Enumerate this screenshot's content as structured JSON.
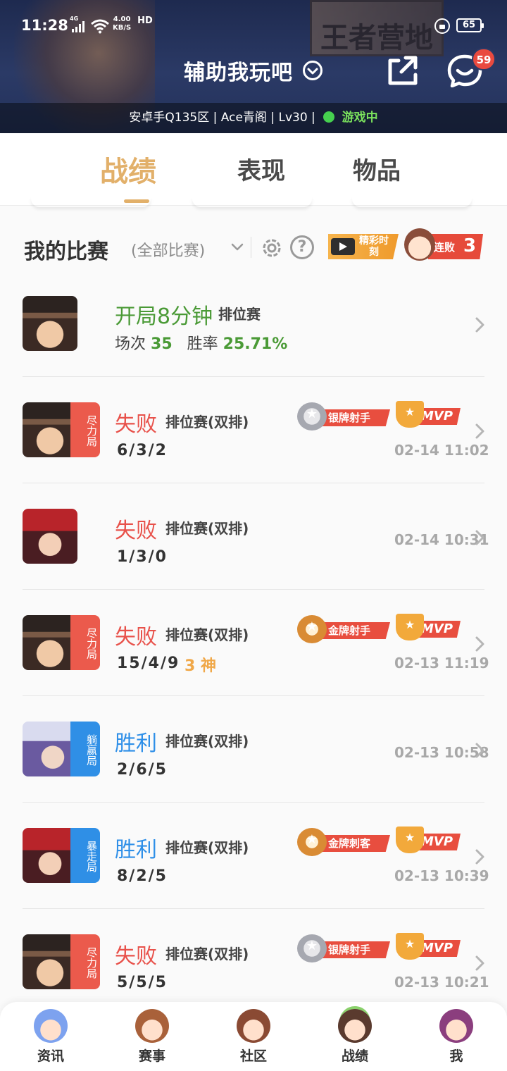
{
  "status_bar": {
    "time": "11:28",
    "network": "4G",
    "speed_value": "4.00",
    "speed_unit": "KB/S",
    "hd": "HD",
    "battery": "65"
  },
  "header": {
    "sign_text": "王者营地",
    "title": "辅助我玩吧",
    "message_badge": "59",
    "profile": {
      "server": "安卓手Q135区",
      "name": "Ace青阁",
      "level": "Lv30",
      "status": "游戏中"
    }
  },
  "tabs": [
    {
      "label": "战绩",
      "active": true
    },
    {
      "label": "表现",
      "active": false
    },
    {
      "label": "物品",
      "active": false
    }
  ],
  "section": {
    "title": "我的比赛",
    "filter": "(全部比赛)",
    "highlight_label": "精彩时刻",
    "streak_label": "连败",
    "streak_count": "3"
  },
  "summary": {
    "result": "开局8分钟",
    "mode": "排位赛",
    "games_label": "场次",
    "games": "35",
    "winrate_label": "胜率",
    "winrate": "25.71%"
  },
  "matches": [
    {
      "result": "失败",
      "mode": "排位赛(双排)",
      "kda": "6/3/2",
      "tag": "尽力局",
      "medal": "银牌射手",
      "mvp": "MVP",
      "time": "02-14 11:02"
    },
    {
      "result": "失败",
      "mode": "排位赛(双排)",
      "kda": "1/3/0",
      "time": "02-14 10:31"
    },
    {
      "result": "失败",
      "mode": "排位赛(双排)",
      "kda": "15/4/9",
      "legend": "3 神",
      "tag": "尽力局",
      "medal": "金牌射手",
      "mvp": "MVP",
      "time": "02-13 11:19"
    },
    {
      "result": "胜利",
      "mode": "排位赛(双排)",
      "kda": "2/6/5",
      "tag": "躺赢局",
      "time": "02-13 10:58"
    },
    {
      "result": "胜利",
      "mode": "排位赛(双排)",
      "kda": "8/2/5",
      "tag": "暴走局",
      "medal": "金牌刺客",
      "mvp": "MVP",
      "time": "02-13 10:39"
    },
    {
      "result": "失败",
      "mode": "排位赛(双排)",
      "kda": "5/5/5",
      "tag": "尽力局",
      "medal": "银牌射手",
      "mvp": "MVP",
      "time": "02-13 10:21"
    }
  ],
  "bottom_nav": [
    {
      "label": "资讯"
    },
    {
      "label": "赛事"
    },
    {
      "label": "社区"
    },
    {
      "label": "战绩",
      "active": true
    },
    {
      "label": "我"
    }
  ],
  "colors": {
    "accent_gold": "#e2b06a",
    "lose_red": "#e8514a",
    "win_blue": "#2e8fe8",
    "green": "#4a9a36"
  }
}
